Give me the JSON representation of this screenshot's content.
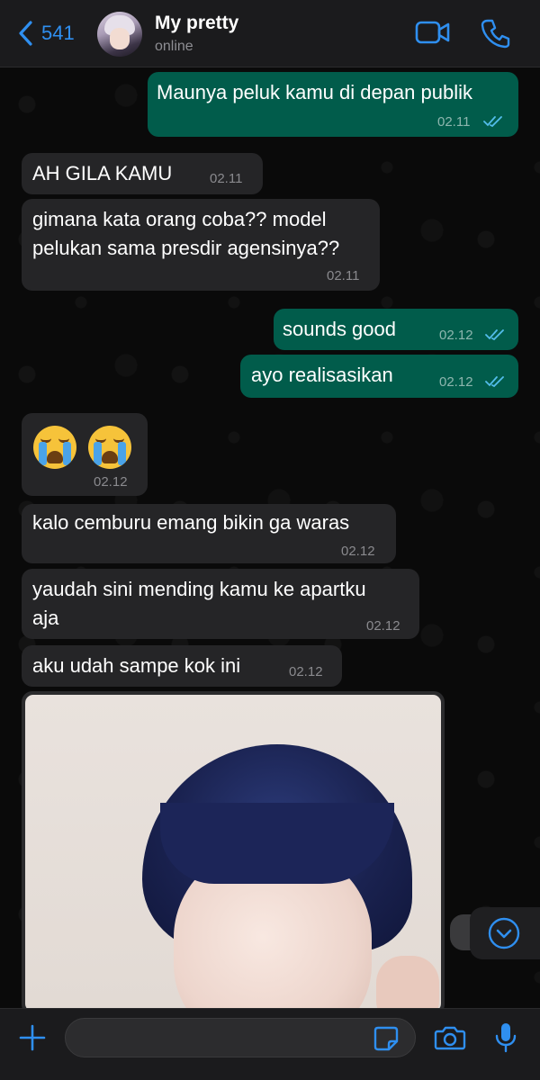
{
  "header": {
    "back_count": "541",
    "contact_name": "My pretty",
    "status": "online",
    "icons": [
      "chevron-left-icon",
      "video-call-icon",
      "phone-icon"
    ]
  },
  "colors": {
    "accent": "#2f8ff0",
    "outgoing_bubble": "#015c4b",
    "incoming_bubble": "#252527",
    "read_ticks": "#53bdeb"
  },
  "messages": [
    {
      "direction": "out",
      "text": "Maunya peluk kamu di depan publik",
      "time": "02.11",
      "read": true
    },
    {
      "direction": "in",
      "text": "AH GILA KAMU",
      "time": "02.11"
    },
    {
      "direction": "in",
      "lines": [
        "gimana kata orang coba?? model",
        "pelukan sama presdir agensinya??"
      ],
      "time": "02.11"
    },
    {
      "direction": "out",
      "text": "sounds good",
      "time": "02.12",
      "read": true
    },
    {
      "direction": "out",
      "text": "ayo realisasikan",
      "time": "02.12",
      "read": true
    },
    {
      "direction": "in",
      "emoji": [
        "loudly-crying-face",
        "loudly-crying-face"
      ],
      "time": "02.12"
    },
    {
      "direction": "in",
      "text": "kalo cemburu emang bikin ga waras",
      "time": "02.12"
    },
    {
      "direction": "in",
      "lines": [
        "yaudah sini mending kamu ke apartku",
        "aja"
      ],
      "time": "02.12"
    },
    {
      "direction": "in",
      "text": "aku udah sampe kok ini",
      "time": "02.12"
    },
    {
      "direction": "in",
      "type": "photo"
    }
  ],
  "composer": {
    "placeholder": "",
    "icons": [
      "plus-icon",
      "sticker-icon",
      "camera-icon",
      "microphone-icon"
    ]
  }
}
